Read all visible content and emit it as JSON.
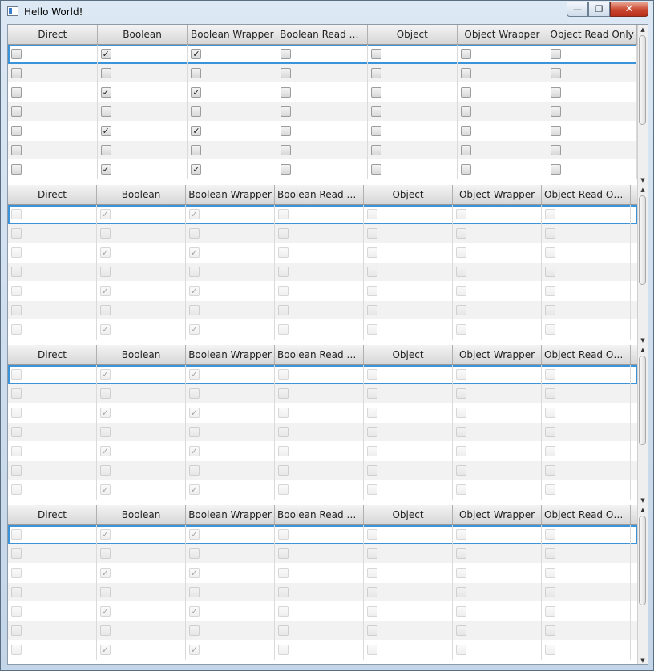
{
  "window": {
    "title": "Hello World!",
    "minimize_glyph": "—",
    "maximize_glyph": "❐",
    "close_glyph": "✕"
  },
  "icons": {
    "app": "app-window-icon",
    "checkmark": "✓",
    "scroll_up": "▲",
    "scroll_down": "▼"
  },
  "colors": {
    "selection": "#3b94d9",
    "title_bar": "#c9d9ea",
    "close_button": "#c9452d"
  },
  "tables": [
    {
      "enabled": true,
      "columns": [
        "Direct",
        "Boolean",
        "Boolean Wrapper",
        "Boolean Read Only",
        "Object",
        "Object Wrapper",
        "Object Read Only"
      ],
      "selected_row": 0,
      "rows": [
        [
          false,
          true,
          true,
          false,
          false,
          false,
          false
        ],
        [
          false,
          false,
          false,
          false,
          false,
          false,
          false
        ],
        [
          false,
          true,
          true,
          false,
          false,
          false,
          false
        ],
        [
          false,
          false,
          false,
          false,
          false,
          false,
          false
        ],
        [
          false,
          true,
          true,
          false,
          false,
          false,
          false
        ],
        [
          false,
          false,
          false,
          false,
          false,
          false,
          false
        ],
        [
          false,
          true,
          true,
          false,
          false,
          false,
          false
        ]
      ]
    },
    {
      "enabled": false,
      "columns": [
        "Direct",
        "Boolean",
        "Boolean Wrapper",
        "Boolean Read O...",
        "Object",
        "Object Wrapper",
        "Object Read Only"
      ],
      "selected_row": 0,
      "rows": [
        [
          false,
          true,
          true,
          false,
          false,
          false,
          false
        ],
        [
          false,
          false,
          false,
          false,
          false,
          false,
          false
        ],
        [
          false,
          true,
          true,
          false,
          false,
          false,
          false
        ],
        [
          false,
          false,
          false,
          false,
          false,
          false,
          false
        ],
        [
          false,
          true,
          true,
          false,
          false,
          false,
          false
        ],
        [
          false,
          false,
          false,
          false,
          false,
          false,
          false
        ],
        [
          false,
          true,
          true,
          false,
          false,
          false,
          false
        ]
      ]
    },
    {
      "enabled": false,
      "columns": [
        "Direct",
        "Boolean",
        "Boolean Wrapper",
        "Boolean Read O...",
        "Object",
        "Object Wrapper",
        "Object Read Only"
      ],
      "selected_row": 0,
      "rows": [
        [
          false,
          true,
          true,
          false,
          false,
          false,
          false
        ],
        [
          false,
          false,
          false,
          false,
          false,
          false,
          false
        ],
        [
          false,
          true,
          true,
          false,
          false,
          false,
          false
        ],
        [
          false,
          false,
          false,
          false,
          false,
          false,
          false
        ],
        [
          false,
          true,
          true,
          false,
          false,
          false,
          false
        ],
        [
          false,
          false,
          false,
          false,
          false,
          false,
          false
        ],
        [
          false,
          true,
          true,
          false,
          false,
          false,
          false
        ]
      ]
    },
    {
      "enabled": false,
      "columns": [
        "Direct",
        "Boolean",
        "Boolean Wrapper",
        "Boolean Read O...",
        "Object",
        "Object Wrapper",
        "Object Read Only"
      ],
      "selected_row": 0,
      "rows": [
        [
          false,
          true,
          true,
          false,
          false,
          false,
          false
        ],
        [
          false,
          false,
          false,
          false,
          false,
          false,
          false
        ],
        [
          false,
          true,
          true,
          false,
          false,
          false,
          false
        ],
        [
          false,
          false,
          false,
          false,
          false,
          false,
          false
        ],
        [
          false,
          true,
          true,
          false,
          false,
          false,
          false
        ],
        [
          false,
          false,
          false,
          false,
          false,
          false,
          false
        ],
        [
          false,
          true,
          true,
          false,
          false,
          false,
          false
        ]
      ]
    }
  ]
}
